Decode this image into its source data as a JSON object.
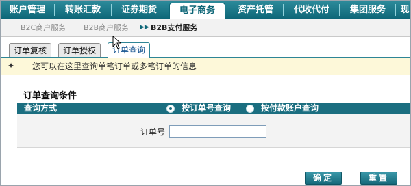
{
  "topnav": {
    "items": [
      {
        "label": "账户管理"
      },
      {
        "label": "转账汇款"
      },
      {
        "label": "证券期货"
      },
      {
        "label": "电子商务"
      },
      {
        "label": "资产托管"
      },
      {
        "label": "代收代付"
      },
      {
        "label": "集团服务"
      },
      {
        "label": "现"
      }
    ],
    "active_index": 3
  },
  "subnav": {
    "items": [
      {
        "label": "B2C商户服务"
      },
      {
        "label": "B2B商户服务"
      },
      {
        "label": "B2B支付服务"
      }
    ],
    "arrow": "▶▶"
  },
  "tabs": [
    {
      "label": "订单复核"
    },
    {
      "label": "订单授权"
    },
    {
      "label": "订单查询"
    }
  ],
  "info": {
    "icon": "pin-icon",
    "pin_glyph": "✦",
    "message": "您可以在这里查询单笔订单或多笔订单的信息"
  },
  "form": {
    "title": "订单查询条件",
    "query_method_label": "查询方式",
    "options": [
      {
        "label": "按订单号查询",
        "selected": true
      },
      {
        "label": "按付款账户查询",
        "selected": false
      }
    ],
    "order_no_label": "订单号",
    "order_no_value": ""
  },
  "buttons": {
    "confirm": "确定",
    "reset": "重置"
  },
  "colors": {
    "nav_bg": "#0d6677",
    "bar_bg": "#1b6e80",
    "info_bg": "#fdf8d9"
  }
}
